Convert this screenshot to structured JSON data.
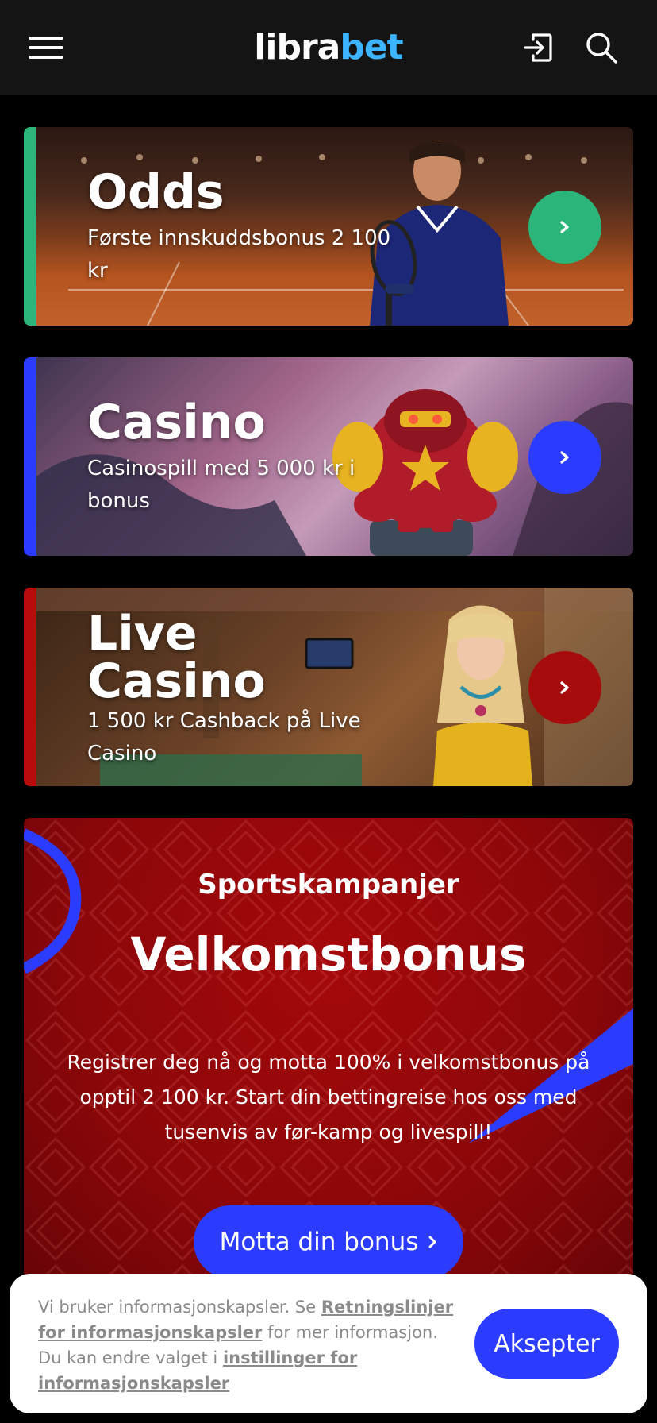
{
  "header": {
    "logo_part1": "libra",
    "logo_part2": "bet"
  },
  "cards": [
    {
      "title": "Odds",
      "subtitle": "Første innskuddsbonus 2 100 kr",
      "accent": "#2bb57a"
    },
    {
      "title": "Casino",
      "subtitle": "Casinospill med 5 000 kr i bonus",
      "accent": "#2b3cff"
    },
    {
      "title_line1": "Live",
      "title_line2": "Casino",
      "subtitle": "1 500 kr Cashback på Live Casino",
      "accent": "#b80c0c"
    }
  ],
  "promo": {
    "eyebrow": "Sportskampanjer",
    "headline": "Velkomstbonus",
    "body": "Registrer deg nå og motta 100% i velkomstbonus på opptil 2 100 kr. Start din bettingreise hos oss med tusenvis av før-kamp og livespill!",
    "cta_label": "Motta din bonus",
    "background": "#9a0709"
  },
  "cookie": {
    "text_1": "Vi bruker informasjonskapsler. Se ",
    "link_1": "Retningslinjer for informasjonskapsler",
    "text_2": " for mer informasjon. Du kan endre valget i ",
    "link_2": "instillinger for informasjonskapsler",
    "accept_label": "Aksepter"
  },
  "icons": {
    "menu": "hamburger-icon",
    "login": "login-icon",
    "search": "search-icon",
    "arrow": "chevron-right-icon"
  },
  "colors": {
    "header_bg": "#141414",
    "brand_blue": "#2b3cff",
    "logo_accent": "#3cb4ff"
  }
}
